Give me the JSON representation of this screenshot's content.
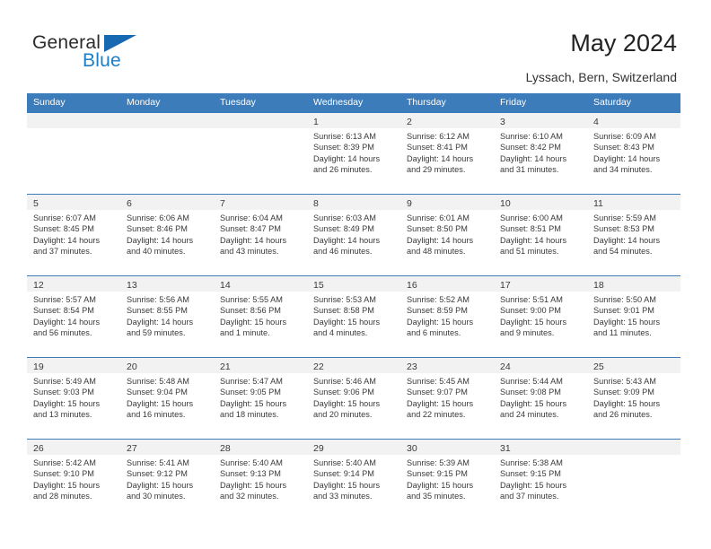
{
  "brand": {
    "name_top": "General",
    "name_bottom": "Blue",
    "triangle_icon": "triangle-icon",
    "accent_color": "#1a7ec8"
  },
  "header": {
    "title": "May 2024",
    "subtitle": "Lyssach, Bern, Switzerland",
    "header_bg_color": "#3c7cba",
    "header_text_color": "#ffffff"
  },
  "calendar": {
    "weekday_headers": [
      "Sunday",
      "Monday",
      "Tuesday",
      "Wednesday",
      "Thursday",
      "Friday",
      "Saturday"
    ],
    "weeks": [
      [
        {
          "day": "",
          "empty": true
        },
        {
          "day": "",
          "empty": true
        },
        {
          "day": "",
          "empty": true
        },
        {
          "day": "1",
          "sunrise": "Sunrise: 6:13 AM",
          "sunset": "Sunset: 8:39 PM",
          "daylight_line1": "Daylight: 14 hours",
          "daylight_line2": "and 26 minutes."
        },
        {
          "day": "2",
          "sunrise": "Sunrise: 6:12 AM",
          "sunset": "Sunset: 8:41 PM",
          "daylight_line1": "Daylight: 14 hours",
          "daylight_line2": "and 29 minutes."
        },
        {
          "day": "3",
          "sunrise": "Sunrise: 6:10 AM",
          "sunset": "Sunset: 8:42 PM",
          "daylight_line1": "Daylight: 14 hours",
          "daylight_line2": "and 31 minutes."
        },
        {
          "day": "4",
          "sunrise": "Sunrise: 6:09 AM",
          "sunset": "Sunset: 8:43 PM",
          "daylight_line1": "Daylight: 14 hours",
          "daylight_line2": "and 34 minutes."
        }
      ],
      [
        {
          "day": "5",
          "sunrise": "Sunrise: 6:07 AM",
          "sunset": "Sunset: 8:45 PM",
          "daylight_line1": "Daylight: 14 hours",
          "daylight_line2": "and 37 minutes."
        },
        {
          "day": "6",
          "sunrise": "Sunrise: 6:06 AM",
          "sunset": "Sunset: 8:46 PM",
          "daylight_line1": "Daylight: 14 hours",
          "daylight_line2": "and 40 minutes."
        },
        {
          "day": "7",
          "sunrise": "Sunrise: 6:04 AM",
          "sunset": "Sunset: 8:47 PM",
          "daylight_line1": "Daylight: 14 hours",
          "daylight_line2": "and 43 minutes."
        },
        {
          "day": "8",
          "sunrise": "Sunrise: 6:03 AM",
          "sunset": "Sunset: 8:49 PM",
          "daylight_line1": "Daylight: 14 hours",
          "daylight_line2": "and 46 minutes."
        },
        {
          "day": "9",
          "sunrise": "Sunrise: 6:01 AM",
          "sunset": "Sunset: 8:50 PM",
          "daylight_line1": "Daylight: 14 hours",
          "daylight_line2": "and 48 minutes."
        },
        {
          "day": "10",
          "sunrise": "Sunrise: 6:00 AM",
          "sunset": "Sunset: 8:51 PM",
          "daylight_line1": "Daylight: 14 hours",
          "daylight_line2": "and 51 minutes."
        },
        {
          "day": "11",
          "sunrise": "Sunrise: 5:59 AM",
          "sunset": "Sunset: 8:53 PM",
          "daylight_line1": "Daylight: 14 hours",
          "daylight_line2": "and 54 minutes."
        }
      ],
      [
        {
          "day": "12",
          "sunrise": "Sunrise: 5:57 AM",
          "sunset": "Sunset: 8:54 PM",
          "daylight_line1": "Daylight: 14 hours",
          "daylight_line2": "and 56 minutes."
        },
        {
          "day": "13",
          "sunrise": "Sunrise: 5:56 AM",
          "sunset": "Sunset: 8:55 PM",
          "daylight_line1": "Daylight: 14 hours",
          "daylight_line2": "and 59 minutes."
        },
        {
          "day": "14",
          "sunrise": "Sunrise: 5:55 AM",
          "sunset": "Sunset: 8:56 PM",
          "daylight_line1": "Daylight: 15 hours",
          "daylight_line2": "and 1 minute."
        },
        {
          "day": "15",
          "sunrise": "Sunrise: 5:53 AM",
          "sunset": "Sunset: 8:58 PM",
          "daylight_line1": "Daylight: 15 hours",
          "daylight_line2": "and 4 minutes."
        },
        {
          "day": "16",
          "sunrise": "Sunrise: 5:52 AM",
          "sunset": "Sunset: 8:59 PM",
          "daylight_line1": "Daylight: 15 hours",
          "daylight_line2": "and 6 minutes."
        },
        {
          "day": "17",
          "sunrise": "Sunrise: 5:51 AM",
          "sunset": "Sunset: 9:00 PM",
          "daylight_line1": "Daylight: 15 hours",
          "daylight_line2": "and 9 minutes."
        },
        {
          "day": "18",
          "sunrise": "Sunrise: 5:50 AM",
          "sunset": "Sunset: 9:01 PM",
          "daylight_line1": "Daylight: 15 hours",
          "daylight_line2": "and 11 minutes."
        }
      ],
      [
        {
          "day": "19",
          "sunrise": "Sunrise: 5:49 AM",
          "sunset": "Sunset: 9:03 PM",
          "daylight_line1": "Daylight: 15 hours",
          "daylight_line2": "and 13 minutes."
        },
        {
          "day": "20",
          "sunrise": "Sunrise: 5:48 AM",
          "sunset": "Sunset: 9:04 PM",
          "daylight_line1": "Daylight: 15 hours",
          "daylight_line2": "and 16 minutes."
        },
        {
          "day": "21",
          "sunrise": "Sunrise: 5:47 AM",
          "sunset": "Sunset: 9:05 PM",
          "daylight_line1": "Daylight: 15 hours",
          "daylight_line2": "and 18 minutes."
        },
        {
          "day": "22",
          "sunrise": "Sunrise: 5:46 AM",
          "sunset": "Sunset: 9:06 PM",
          "daylight_line1": "Daylight: 15 hours",
          "daylight_line2": "and 20 minutes."
        },
        {
          "day": "23",
          "sunrise": "Sunrise: 5:45 AM",
          "sunset": "Sunset: 9:07 PM",
          "daylight_line1": "Daylight: 15 hours",
          "daylight_line2": "and 22 minutes."
        },
        {
          "day": "24",
          "sunrise": "Sunrise: 5:44 AM",
          "sunset": "Sunset: 9:08 PM",
          "daylight_line1": "Daylight: 15 hours",
          "daylight_line2": "and 24 minutes."
        },
        {
          "day": "25",
          "sunrise": "Sunrise: 5:43 AM",
          "sunset": "Sunset: 9:09 PM",
          "daylight_line1": "Daylight: 15 hours",
          "daylight_line2": "and 26 minutes."
        }
      ],
      [
        {
          "day": "26",
          "sunrise": "Sunrise: 5:42 AM",
          "sunset": "Sunset: 9:10 PM",
          "daylight_line1": "Daylight: 15 hours",
          "daylight_line2": "and 28 minutes."
        },
        {
          "day": "27",
          "sunrise": "Sunrise: 5:41 AM",
          "sunset": "Sunset: 9:12 PM",
          "daylight_line1": "Daylight: 15 hours",
          "daylight_line2": "and 30 minutes."
        },
        {
          "day": "28",
          "sunrise": "Sunrise: 5:40 AM",
          "sunset": "Sunset: 9:13 PM",
          "daylight_line1": "Daylight: 15 hours",
          "daylight_line2": "and 32 minutes."
        },
        {
          "day": "29",
          "sunrise": "Sunrise: 5:40 AM",
          "sunset": "Sunset: 9:14 PM",
          "daylight_line1": "Daylight: 15 hours",
          "daylight_line2": "and 33 minutes."
        },
        {
          "day": "30",
          "sunrise": "Sunrise: 5:39 AM",
          "sunset": "Sunset: 9:15 PM",
          "daylight_line1": "Daylight: 15 hours",
          "daylight_line2": "and 35 minutes."
        },
        {
          "day": "31",
          "sunrise": "Sunrise: 5:38 AM",
          "sunset": "Sunset: 9:15 PM",
          "daylight_line1": "Daylight: 15 hours",
          "daylight_line2": "and 37 minutes."
        },
        {
          "day": "",
          "empty": true
        }
      ]
    ]
  }
}
